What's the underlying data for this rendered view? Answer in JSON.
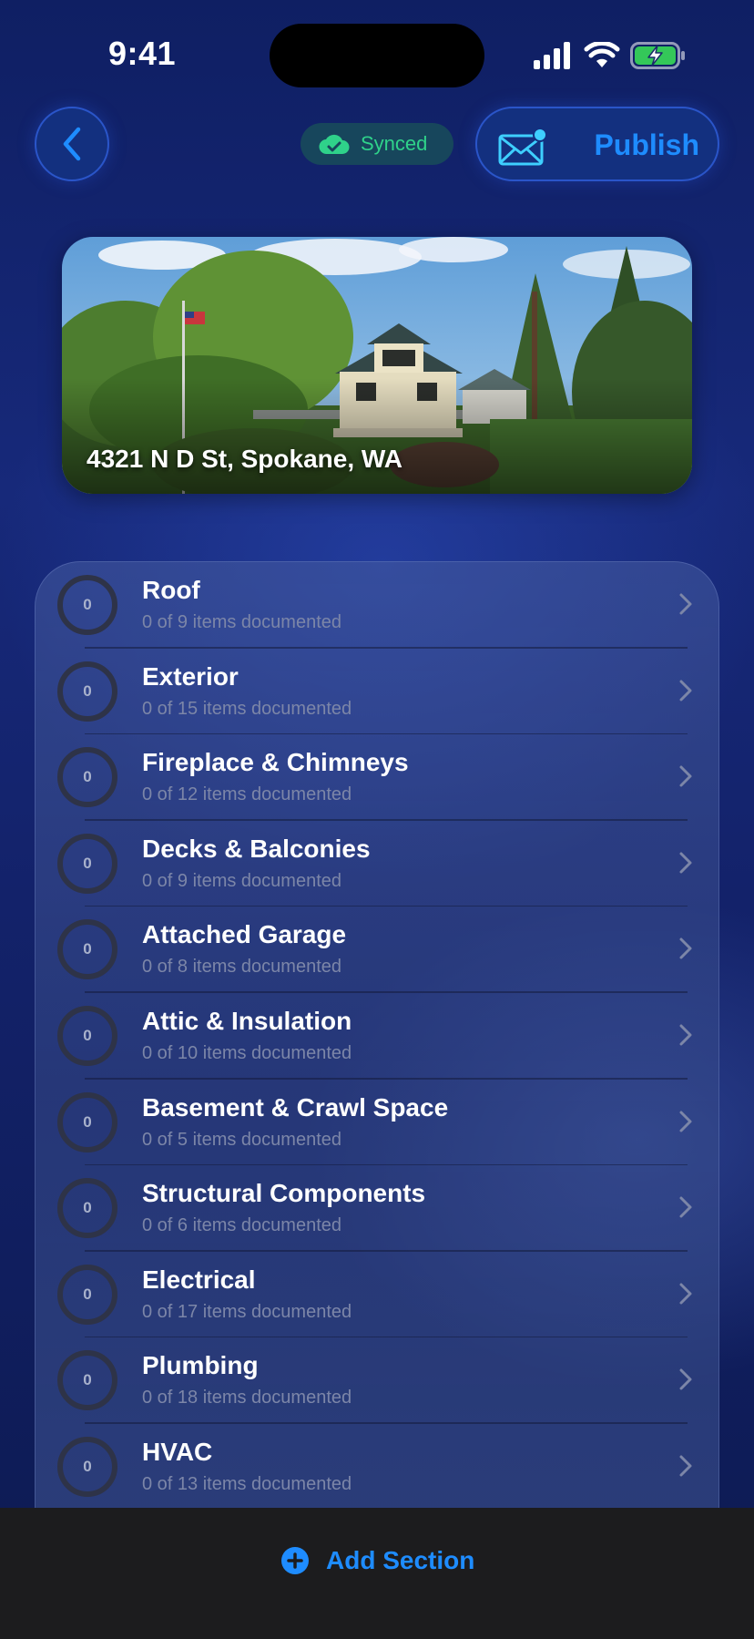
{
  "status_bar": {
    "time": "9:41"
  },
  "toolbar": {
    "back_icon": "chevron-left-icon",
    "sync_status": "Synced",
    "sync_icon": "cloud-check-icon",
    "publish_label": "Publish",
    "publish_icon": "mail-badge-icon"
  },
  "property": {
    "address": "4321 N D St, Spokane, WA"
  },
  "sections": [
    {
      "title": "Roof",
      "progress": "0",
      "subtitle": "0 of 9 items documented"
    },
    {
      "title": "Exterior",
      "progress": "0",
      "subtitle": "0 of 15 items documented"
    },
    {
      "title": "Fireplace & Chimneys",
      "progress": "0",
      "subtitle": "0 of 12 items documented"
    },
    {
      "title": "Decks & Balconies",
      "progress": "0",
      "subtitle": "0 of 9 items documented"
    },
    {
      "title": "Attached Garage",
      "progress": "0",
      "subtitle": "0 of 8 items documented"
    },
    {
      "title": "Attic & Insulation",
      "progress": "0",
      "subtitle": "0 of 10 items documented"
    },
    {
      "title": "Basement & Crawl Space",
      "progress": "0",
      "subtitle": "0 of 5 items documented"
    },
    {
      "title": "Structural Components",
      "progress": "0",
      "subtitle": "0 of 6 items documented"
    },
    {
      "title": "Electrical",
      "progress": "0",
      "subtitle": "0 of 17 items documented"
    },
    {
      "title": "Plumbing",
      "progress": "0",
      "subtitle": "0 of 18 items documented"
    },
    {
      "title": "HVAC",
      "progress": "0",
      "subtitle": "0 of 13 items documented"
    }
  ],
  "footer": {
    "add_section_label": "Add Section",
    "add_icon": "plus-circle-icon"
  },
  "colors": {
    "accent": "#1e8cff",
    "synced_green": "#2fd28a",
    "background": "#13226a",
    "bottom_bar": "#1c1c1e"
  }
}
